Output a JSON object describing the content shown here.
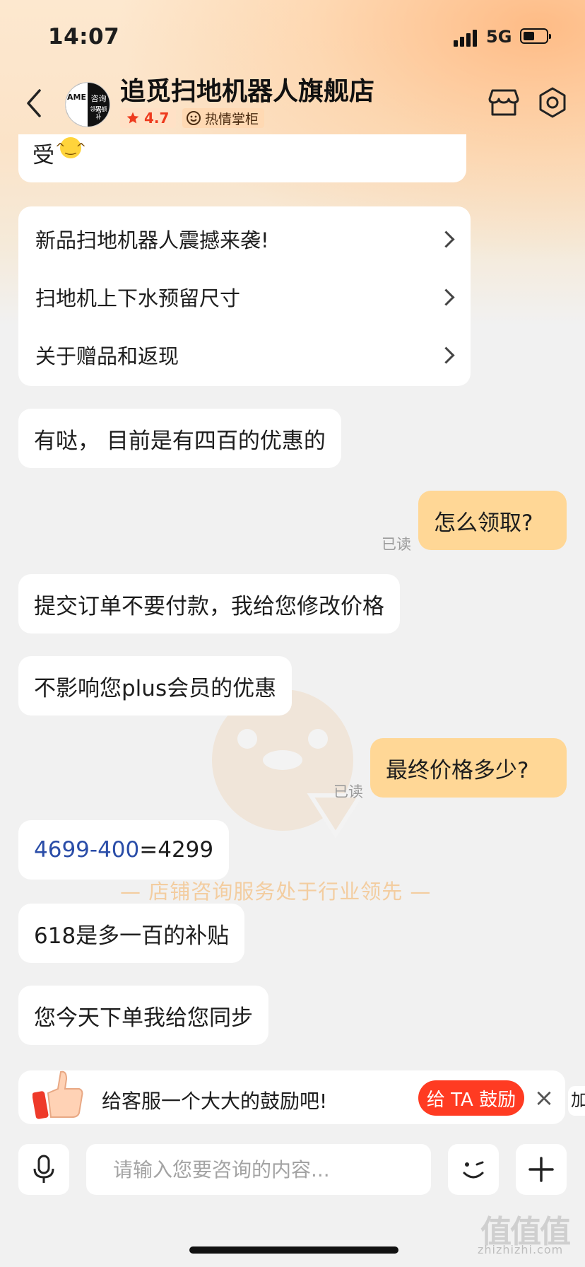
{
  "status_bar": {
    "time": "14:07",
    "network": "5G"
  },
  "header": {
    "store_name": "追觅扫地机器人旗舰店",
    "avatar_text_left": "AME",
    "avatar_text_right": "咨询号",
    "avatar_text_small": "领大额补",
    "rating": "4.7",
    "badge": "热情掌柜"
  },
  "messages": {
    "partial_text": "受",
    "faq": [
      "新品扫地机器人震撼来袭!",
      "扫地机上下水预留尺寸",
      "关于赠品和返现"
    ],
    "m1": "有哒， 目前是有四百的优惠的",
    "m2": "怎么领取?",
    "m3": "提交订单不要付款，我给您修改价格",
    "m4": "不影响您plus会员的优惠",
    "m5": "最终价格多少?",
    "m6_link": "4699-400",
    "m6_rest": "=4299",
    "m7": "618是多一百的补贴",
    "m8": "您今天下单我给您同步",
    "read_label": "已读"
  },
  "watermark_text": "—  店铺咨询服务处于行业领先  —",
  "encourage": {
    "text": "给客服一个大大的鼓励吧!",
    "button": "给 TA 鼓励",
    "close": "×",
    "side_tag": "加"
  },
  "input_bar": {
    "placeholder": "请输入您要咨询的内容..."
  },
  "site": {
    "logo": "值值值",
    "url": "zhizhizhi.com"
  },
  "colors": {
    "accent_red": "#ff3b22",
    "my_bubble": "#ffd796",
    "link_blue": "#2a4da8"
  }
}
